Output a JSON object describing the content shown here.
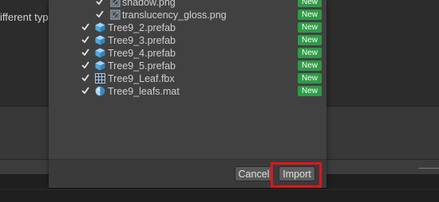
{
  "background": {
    "partial_text": "ifferent typ"
  },
  "colors": {
    "new_badge": "#2f9b48",
    "highlight": "#e3141c"
  },
  "dialog": {
    "items": [
      {
        "label": "shadow.png",
        "icon": "texture-icon",
        "checked": true,
        "badge": "New"
      },
      {
        "label": "translucency_gloss.png",
        "icon": "texture-icon",
        "checked": true,
        "badge": "New"
      },
      {
        "label": "Tree9_2.prefab",
        "icon": "prefab-icon",
        "checked": true,
        "badge": "New"
      },
      {
        "label": "Tree9_3.prefab",
        "icon": "prefab-icon",
        "checked": true,
        "badge": "New"
      },
      {
        "label": "Tree9_4.prefab",
        "icon": "prefab-icon",
        "checked": true,
        "badge": "New"
      },
      {
        "label": "Tree9_5.prefab",
        "icon": "prefab-icon",
        "checked": true,
        "badge": "New"
      },
      {
        "label": "Tree9_Leaf.fbx",
        "icon": "mesh-icon",
        "checked": true,
        "badge": "New"
      },
      {
        "label": "Tree9_leafs.mat",
        "icon": "material-icon",
        "checked": true,
        "badge": "New"
      }
    ],
    "cancel_label": "Cancel",
    "import_label": "Import"
  }
}
